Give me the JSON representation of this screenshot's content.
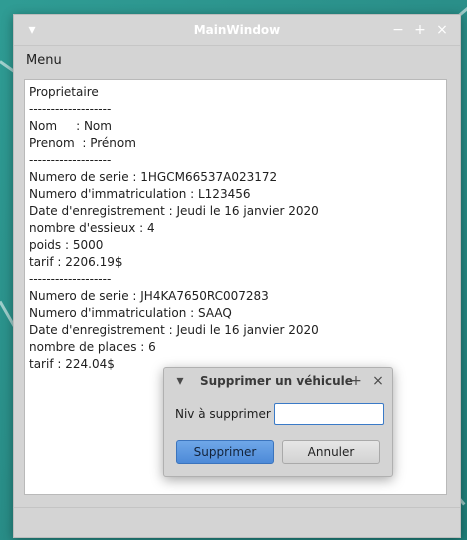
{
  "window": {
    "title": "MainWindow",
    "buttons": {
      "menu": "▾",
      "minimize": "−",
      "maximize": "+",
      "close": "×"
    }
  },
  "menubar": {
    "items": [
      "Menu"
    ]
  },
  "content": {
    "lines": [
      "Proprietaire",
      "-------------------",
      "Nom     : Nom",
      "Prenom  : Prénom",
      "-------------------",
      "Numero de serie : 1HGCM66537A023172",
      "Numero d'immatriculation : L123456",
      "Date d'enregistrement : Jeudi le 16 janvier 2020",
      "nombre d'essieux : 4",
      "poids : 5000",
      "tarif : 2206.19$",
      "-------------------",
      "Numero de serie : JH4KA7650RC007283",
      "Numero d'immatriculation : SAAQ",
      "Date d'enregistrement : Jeudi le 16 janvier 2020",
      "nombre de places : 6",
      "tarif : 224.04$"
    ]
  },
  "dialog": {
    "title": "Supprimer un véhicule",
    "buttons": {
      "menu": "▾",
      "maximize": "+",
      "close": "×"
    },
    "field_label": "Niv à supprimer",
    "field_value": "",
    "primary_button": "Supprimer",
    "secondary_button": "Annuler"
  },
  "colors": {
    "desktop": "#2a8f89",
    "accent": "#4d8ad8",
    "window": "#d4d4d4"
  }
}
